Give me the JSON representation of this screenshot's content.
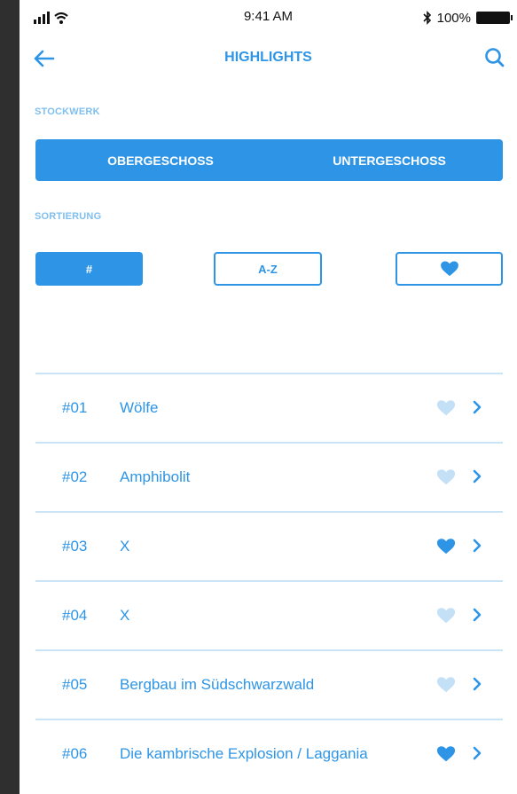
{
  "status_bar": {
    "time": "9:41 AM",
    "battery": "100%",
    "signal_icon": "signal-icon",
    "wifi_icon": "wifi-icon",
    "bluetooth_icon": "bluetooth-icon",
    "battery_icon": "battery-icon"
  },
  "header": {
    "title": "HIGHLIGHTS",
    "back_icon": "arrow-left-icon",
    "search_icon": "search-icon"
  },
  "colors": {
    "accent": "#2e95e6",
    "accent_light": "#c4e0f6",
    "label": "#7fbfef"
  },
  "floor": {
    "label": "STOCKWERK",
    "buttons": [
      "OBERGESCHOSS",
      "UNTERGESCHOSS"
    ]
  },
  "sort": {
    "label": "SORTIERUNG",
    "buttons": [
      "#",
      "A-Z"
    ],
    "favorite_icon": "heart-icon"
  },
  "items": [
    {
      "number": "#01",
      "name": "Wölfe",
      "favorite": false
    },
    {
      "number": "#02",
      "name": "Amphibolit",
      "favorite": false
    },
    {
      "number": "#03",
      "name": "X",
      "favorite": true
    },
    {
      "number": "#04",
      "name": "X",
      "favorite": false
    },
    {
      "number": "#05",
      "name": "Bergbau im Südschwarzwald",
      "favorite": false
    },
    {
      "number": "#06",
      "name": "Die kambrische Explosion / Laggania",
      "favorite": true
    }
  ]
}
